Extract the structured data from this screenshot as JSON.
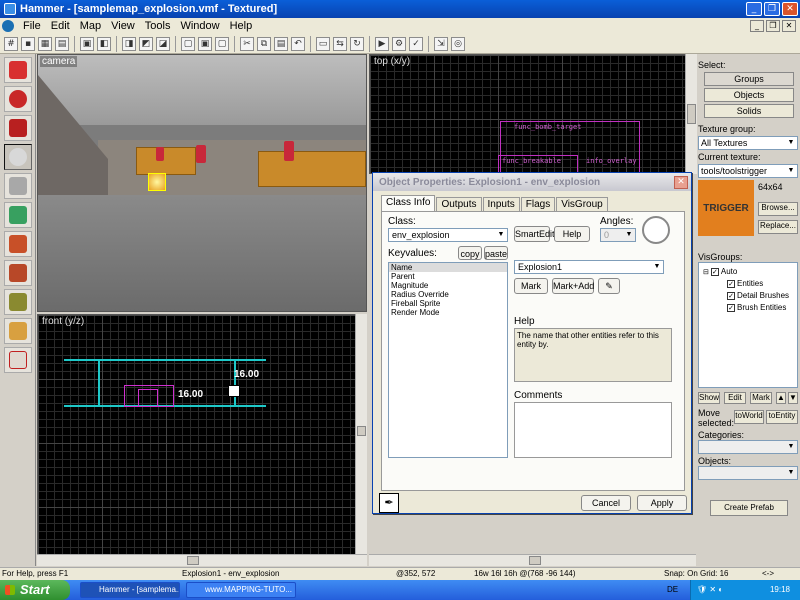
{
  "window": {
    "title": "Hammer - [samplemap_explosion.vmf - Textured]"
  },
  "menu": [
    "File",
    "Edit",
    "Map",
    "View",
    "Tools",
    "Window",
    "Help"
  ],
  "viewports": {
    "camera": "camera",
    "top": "top (x/y)",
    "front": "front (y/z)"
  },
  "top_view": {
    "labels": [
      "func_bomb_target",
      "func_breakable",
      "info_overlay"
    ]
  },
  "front_view": {
    "dim_width": "16.00",
    "dim_height": "16.00"
  },
  "dialog": {
    "title": "Object Properties: Explosion1 - env_explosion",
    "tabs": [
      "Class Info",
      "Outputs",
      "Inputs",
      "Flags",
      "VisGroup"
    ],
    "class_label": "Class:",
    "class_value": "env_explosion",
    "smartedit": "SmartEdit",
    "help_btn": "Help",
    "angles_label": "Angles:",
    "angles_value": "0",
    "keyvalues_label": "Keyvalues:",
    "copy": "copy",
    "paste": "paste",
    "keyvalues": [
      "Name",
      "Parent",
      "Magnitude",
      "Radius Override",
      "Fireball Sprite",
      "Render Mode"
    ],
    "value": "Explosion1",
    "mark": "Mark",
    "mark_add": "Mark+Add",
    "help_label": "Help",
    "help_text": "The name that other entities refer to this entity by.",
    "comments_label": "Comments",
    "cancel": "Cancel",
    "apply": "Apply"
  },
  "right_panel": {
    "select_label": "Select:",
    "groups": "Groups",
    "objects": "Objects",
    "solids": "Solids",
    "texture_group_label": "Texture group:",
    "texture_group": "All Textures",
    "current_texture_label": "Current texture:",
    "current_texture": "tools/toolstrigger",
    "texture_size": "64x64",
    "texture_preview": "TRIGGER",
    "browse": "Browse...",
    "replace": "Replace...",
    "visgroups_label": "VisGroups:",
    "visgroups": {
      "root": "Auto",
      "children": [
        "Entities",
        "Detail Brushes",
        "Brush Entities"
      ]
    },
    "show": "Show",
    "edit": "Edit",
    "mark": "Mark",
    "move_selected": "Move selected:",
    "to_world": "toWorld",
    "to_entity": "toEntity",
    "categories_label": "Categories:",
    "objects_label": "Objects:",
    "create_prefab": "Create Prefab"
  },
  "status": {
    "help": "For Help, press F1",
    "selection": "Explosion1 - env_explosion",
    "coords": "@352, 572",
    "size": "16w 16l 16h @(768 -96 144)",
    "snap": "Snap: On Grid: 16",
    "nav": "<->"
  },
  "taskbar": {
    "start": "Start",
    "items": [
      "Hammer - [samplema...",
      "www.MAPPING-TUTO..."
    ],
    "lang": "DE",
    "time": "19:18"
  }
}
